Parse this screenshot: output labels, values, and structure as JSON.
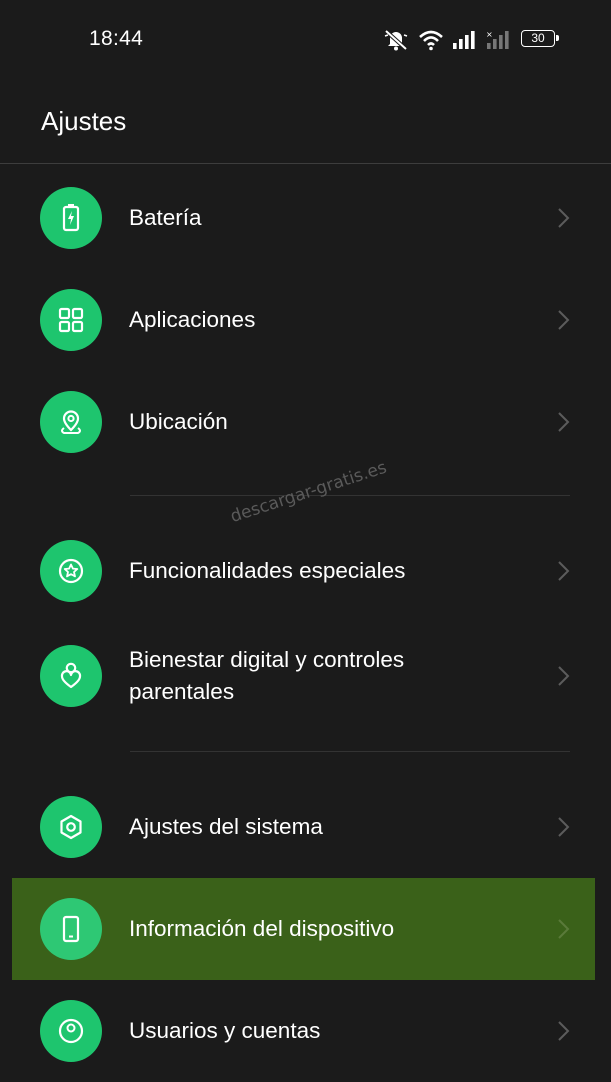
{
  "status_bar": {
    "time": "18:44",
    "battery": "30",
    "icons": [
      "mute-icon",
      "wifi-icon",
      "signal-icon",
      "no-signal-icon",
      "battery-icon"
    ]
  },
  "header": {
    "title": "Ajustes"
  },
  "watermark": "descargar-gratis.es",
  "colors": {
    "accent": "#1ec56e",
    "background": "#1b1b1b",
    "highlight": "#3a6119"
  },
  "items": [
    {
      "label": "Batería",
      "icon": "battery-charging-icon"
    },
    {
      "label": "Aplicaciones",
      "icon": "apps-grid-icon"
    },
    {
      "label": "Ubicación",
      "icon": "location-pin-icon"
    },
    {
      "label": "Funcionalidades especiales",
      "icon": "star-circle-icon"
    },
    {
      "label_line1": "Bienestar digital y controles",
      "label_line2": "parentales",
      "icon": "heart-person-icon"
    },
    {
      "label": "Ajustes del sistema",
      "icon": "hexagon-settings-icon"
    },
    {
      "label": "Información del dispositivo",
      "icon": "phone-device-icon",
      "selected": true
    },
    {
      "label": "Usuarios y cuentas",
      "icon": "user-icon"
    }
  ]
}
